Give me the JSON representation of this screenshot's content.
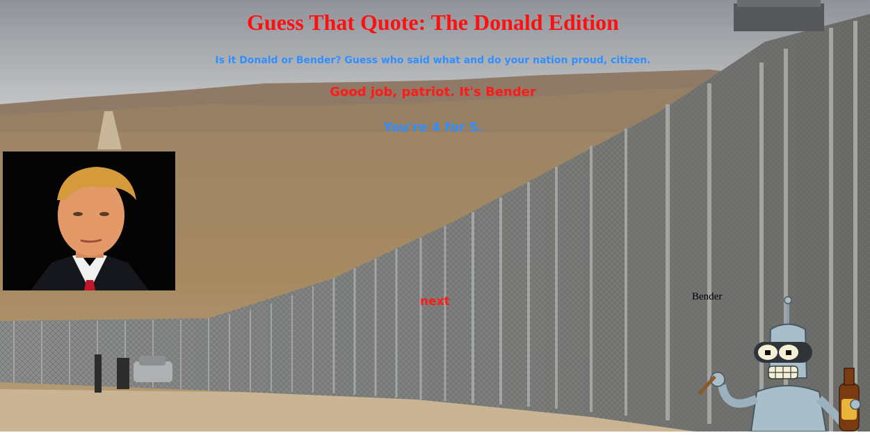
{
  "header": {
    "title": "Guess That Quote: The Donald Edition",
    "subtitle": "Is it Donald or Bender? Guess who said what and do your nation proud, citizen."
  },
  "result": {
    "feedback": "Good job, patriot. It's Bender",
    "score": "You're 4 for 5."
  },
  "choices": {
    "bender_label": "Bender",
    "next_label": "next"
  },
  "colors": {
    "title_red": "#ff1010",
    "accent_blue": "#2f8fff",
    "feedback_red": "#ff1a1a"
  },
  "images": {
    "background": "desert-border-fence-photo",
    "left_choice": "donald-portrait-photo",
    "right_choice": "bender-robot-illustration"
  }
}
